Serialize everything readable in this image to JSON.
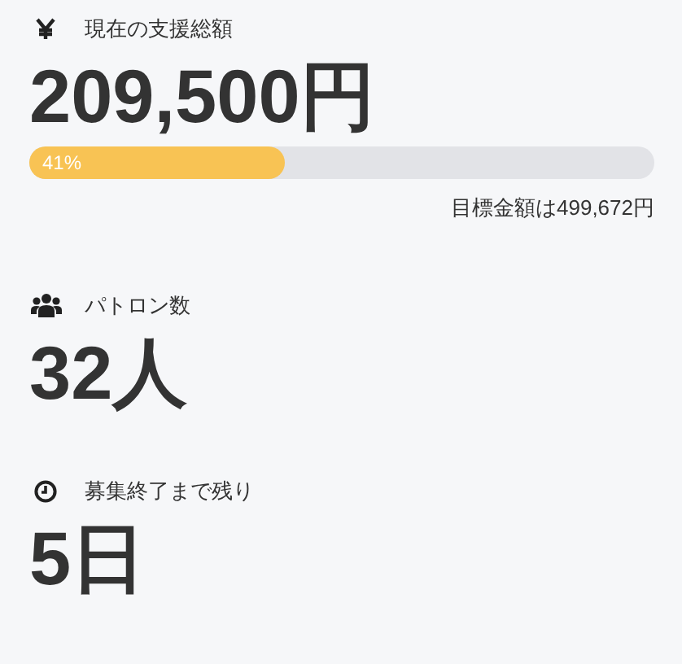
{
  "stats": [
    {
      "kind": "amount",
      "label": "現在の支援総額",
      "value": "209,500円",
      "progress": {
        "level": 0.41,
        "text": "41%"
      },
      "goal": "目標金額は499,672円"
    },
    {
      "kind": "patrons",
      "label": "パトロン数",
      "value": "32人"
    },
    {
      "kind": "days",
      "label": "募集終了まで残り",
      "value": "5日"
    }
  ]
}
